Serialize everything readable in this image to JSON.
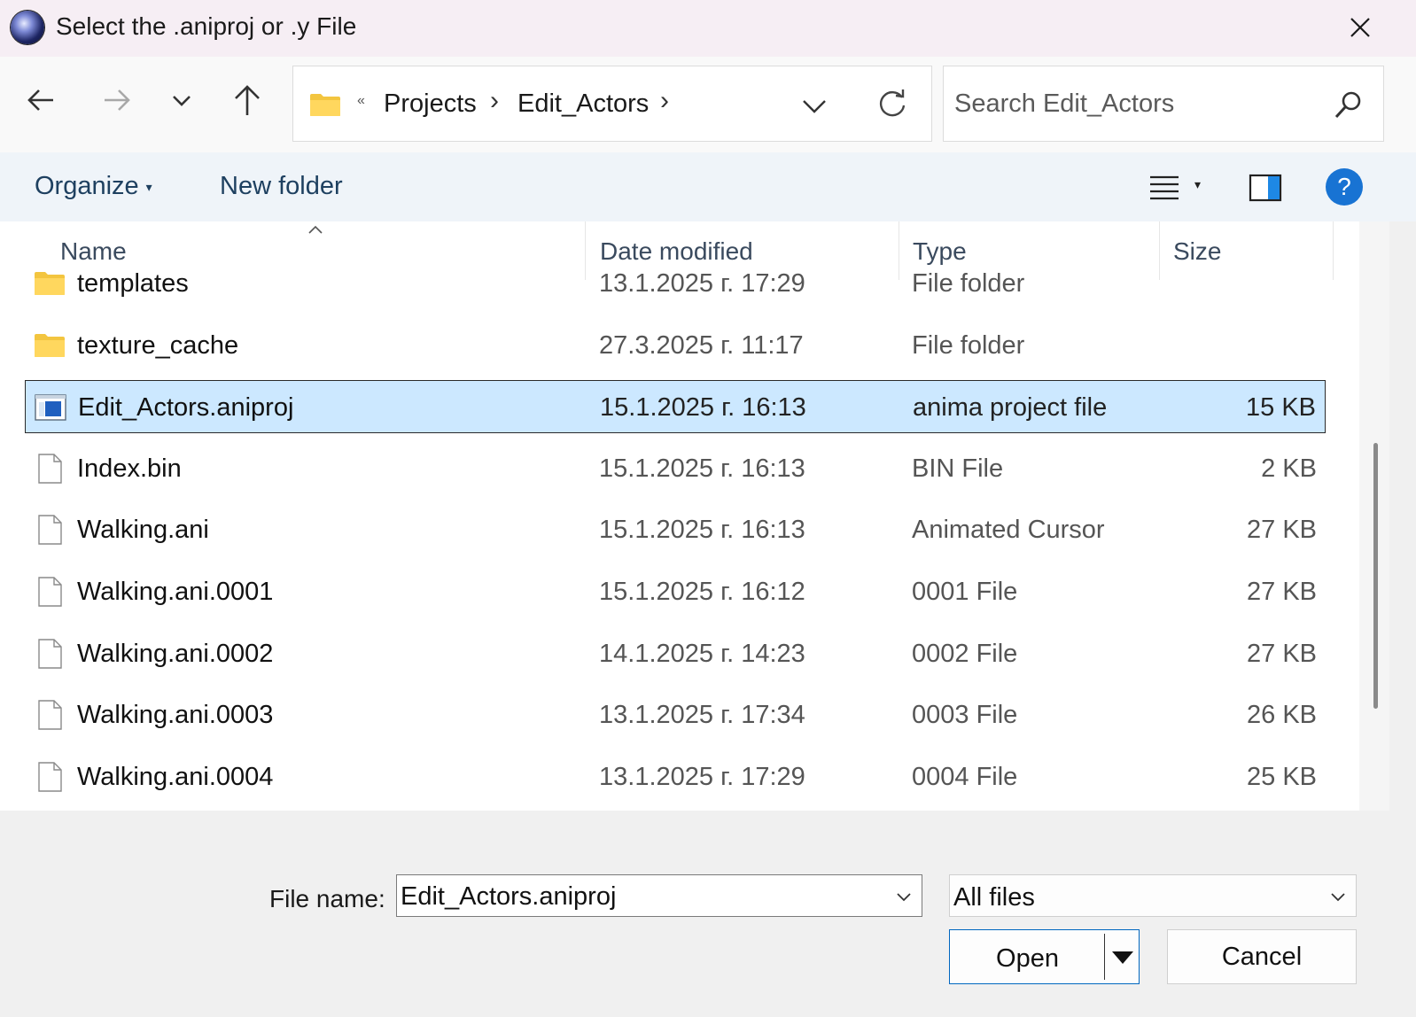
{
  "window": {
    "title": "Select the .aniproj or .y File"
  },
  "nav": {
    "breadcrumbs": [
      "Projects",
      "Edit_Actors"
    ],
    "search_placeholder": "Search Edit_Actors"
  },
  "commands": {
    "organize": "Organize",
    "new_folder": "New folder",
    "help": "?"
  },
  "columns": {
    "name": "Name",
    "date": "Date modified",
    "type": "Type",
    "size": "Size"
  },
  "files": [
    {
      "name": "templates",
      "date": "13.1.2025 г. 17:29",
      "type": "File folder",
      "size": "",
      "icon": "folder-icon"
    },
    {
      "name": "texture_cache",
      "date": "27.3.2025 г. 11:17",
      "type": "File folder",
      "size": "",
      "icon": "folder-icon"
    },
    {
      "name": "Edit_Actors.aniproj",
      "date": "15.1.2025 г. 16:13",
      "type": "anima project file",
      "size": "15 KB",
      "icon": "aniproj-file-icon",
      "selected": true
    },
    {
      "name": "Index.bin",
      "date": "15.1.2025 г. 16:13",
      "type": "BIN File",
      "size": "2 KB",
      "icon": "file-icon"
    },
    {
      "name": "Walking.ani",
      "date": "15.1.2025 г. 16:13",
      "type": "Animated Cursor",
      "size": "27 KB",
      "icon": "file-icon"
    },
    {
      "name": "Walking.ani.0001",
      "date": "15.1.2025 г. 16:12",
      "type": "0001 File",
      "size": "27 KB",
      "icon": "file-icon"
    },
    {
      "name": "Walking.ani.0002",
      "date": "14.1.2025 г. 14:23",
      "type": "0002 File",
      "size": "27 KB",
      "icon": "file-icon"
    },
    {
      "name": "Walking.ani.0003",
      "date": "13.1.2025 г. 17:34",
      "type": "0003 File",
      "size": "26 KB",
      "icon": "file-icon"
    },
    {
      "name": "Walking.ani.0004",
      "date": "13.1.2025 г. 17:29",
      "type": "0004 File",
      "size": "25 KB",
      "icon": "file-icon"
    }
  ],
  "footer": {
    "file_name_label": "File name:",
    "file_name_value": "Edit_Actors.aniproj",
    "file_type": "All files",
    "open_label": "Open",
    "cancel_label": "Cancel"
  }
}
